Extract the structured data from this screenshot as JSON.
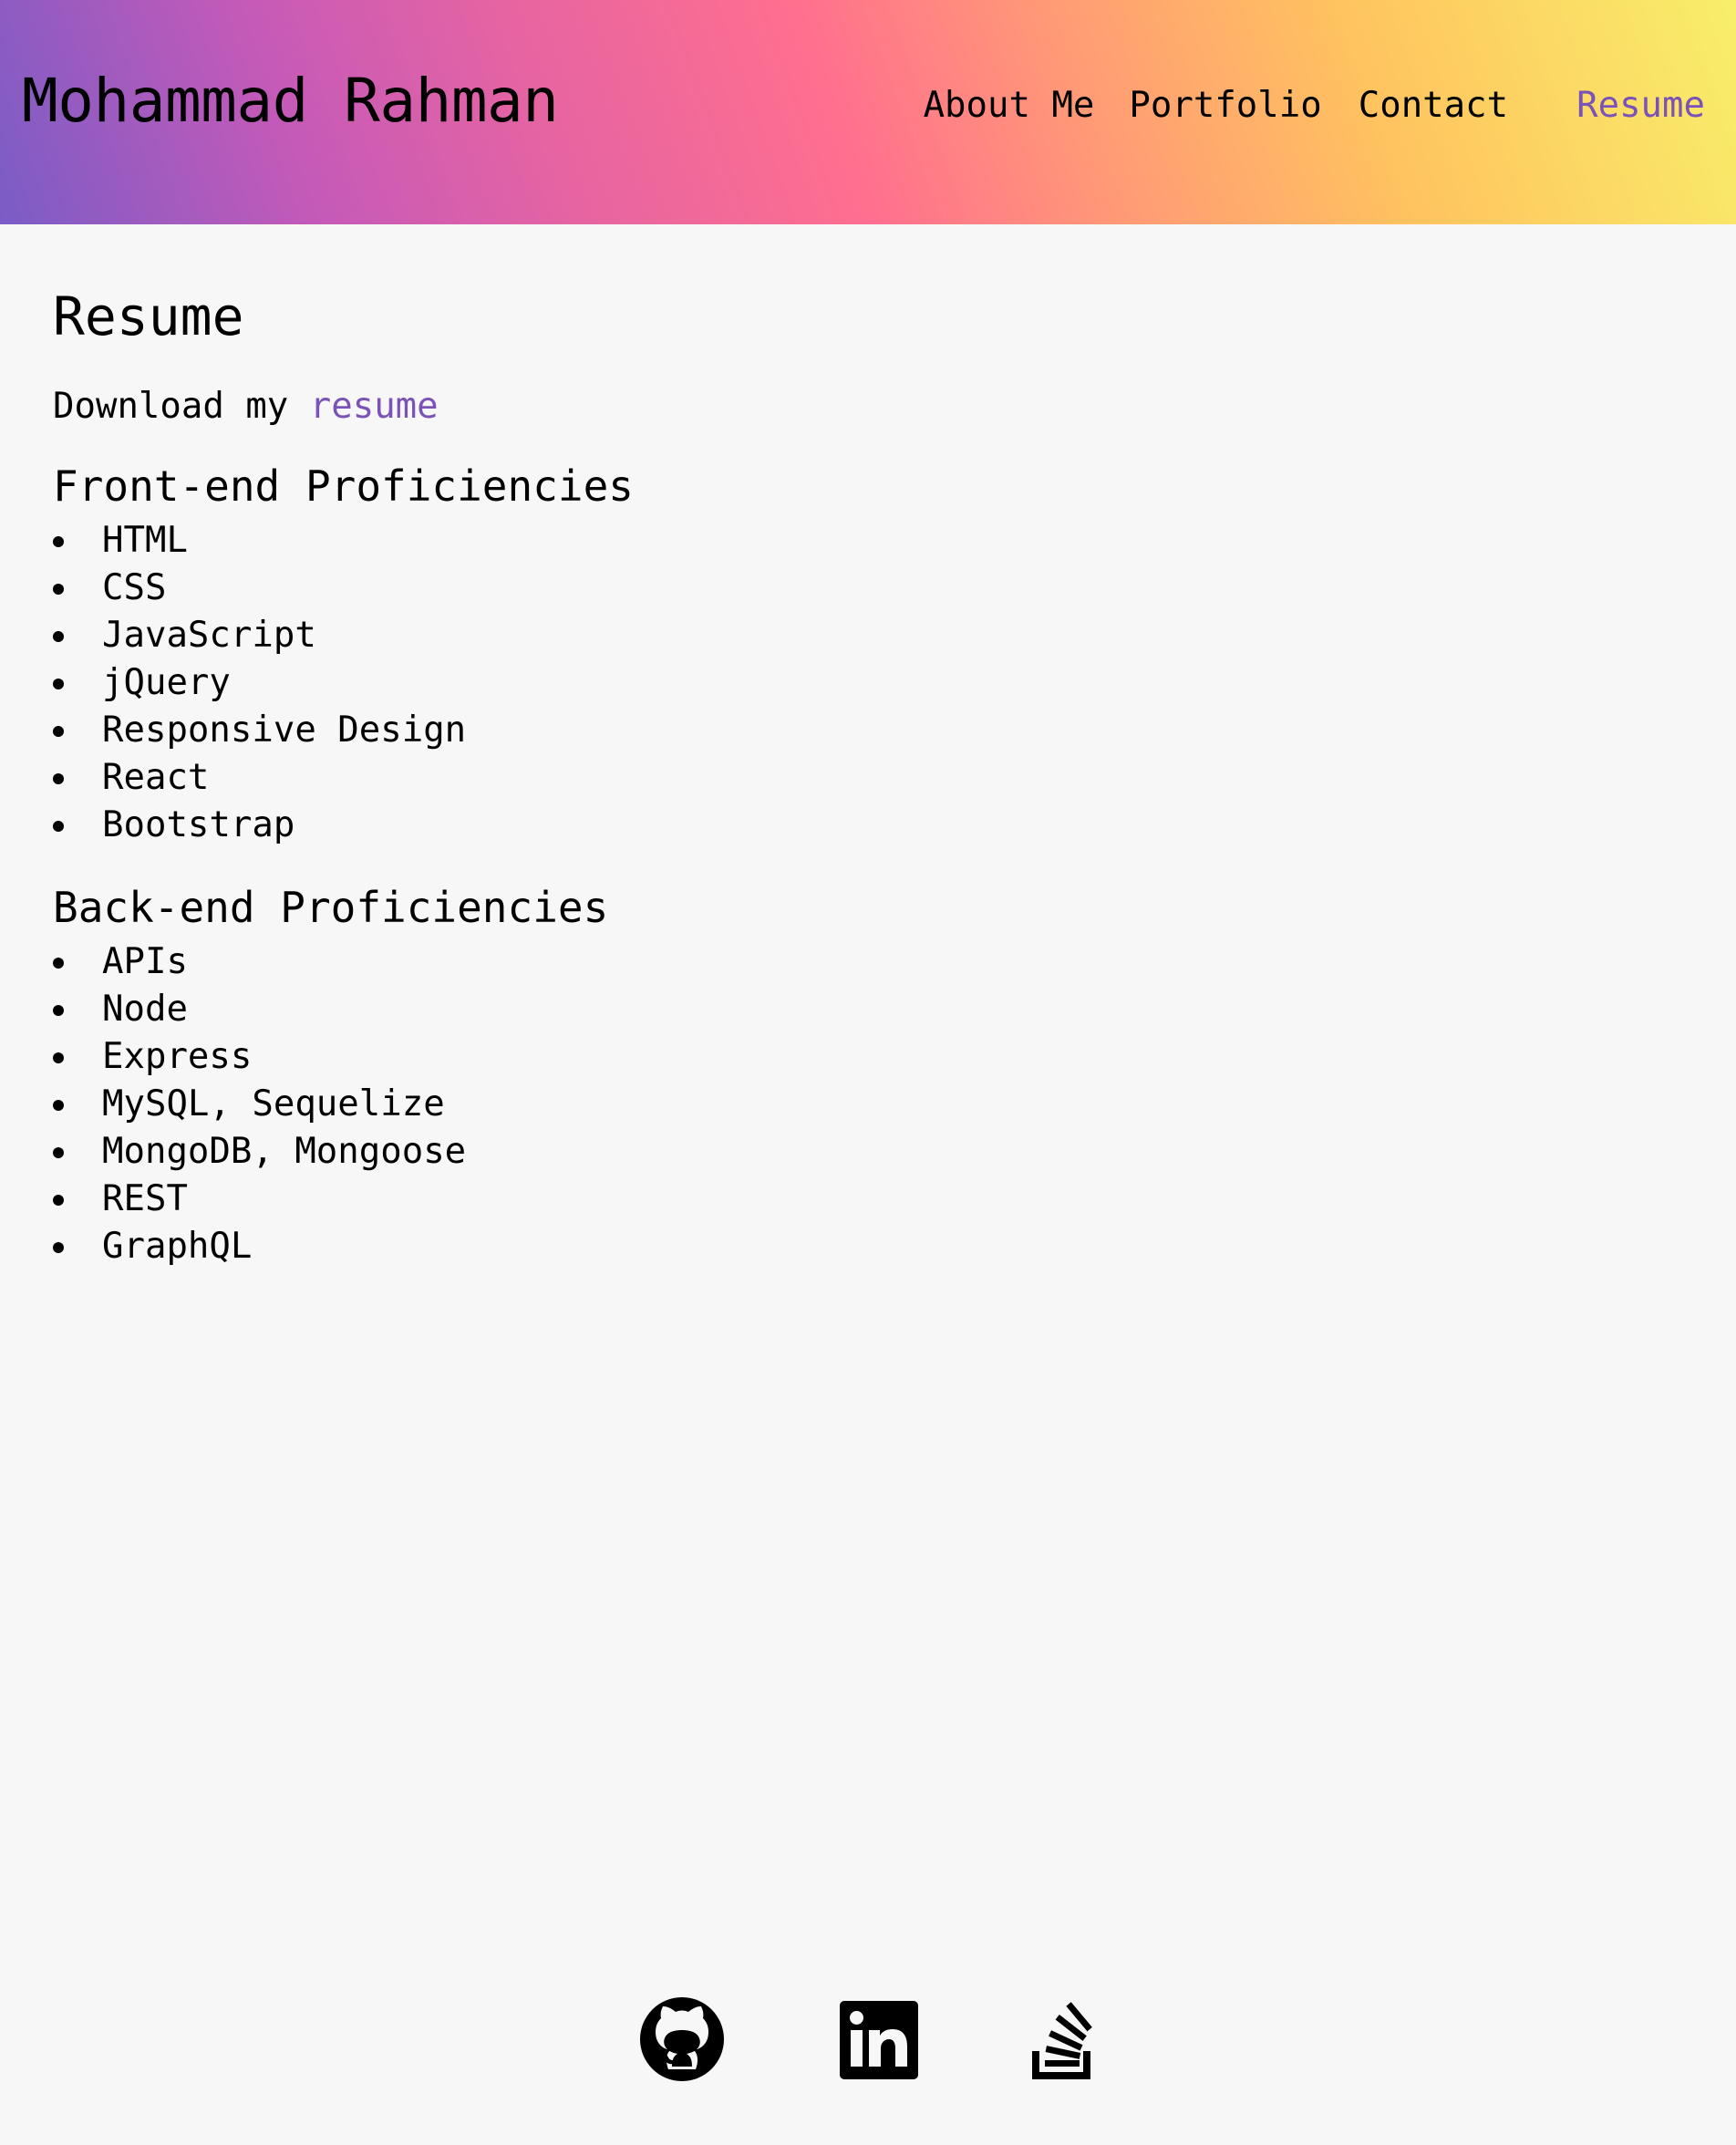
{
  "header": {
    "brand": "Mohammad Rahman",
    "nav": {
      "about": "About Me",
      "portfolio": "Portfolio",
      "contact": "Contact",
      "resume": "Resume"
    }
  },
  "main": {
    "title": "Resume",
    "download_prefix": "Download my",
    "download_link": "resume",
    "front_end": {
      "title": "Front-end Proficiencies",
      "items": [
        "HTML",
        "CSS",
        "JavaScript",
        "jQuery",
        "Responsive Design",
        "React",
        "Bootstrap"
      ]
    },
    "back_end": {
      "title": "Back-end Proficiencies",
      "items": [
        "APIs",
        "Node",
        "Express",
        "MySQL, Sequelize",
        "MongoDB, Mongoose",
        "REST",
        "GraphQL"
      ]
    }
  },
  "footer": {
    "icons": [
      "github-icon",
      "linkedin-icon",
      "stack-overflow-icon"
    ]
  },
  "colors": {
    "accent": "#7a52b8",
    "background": "#f7f7f7"
  }
}
